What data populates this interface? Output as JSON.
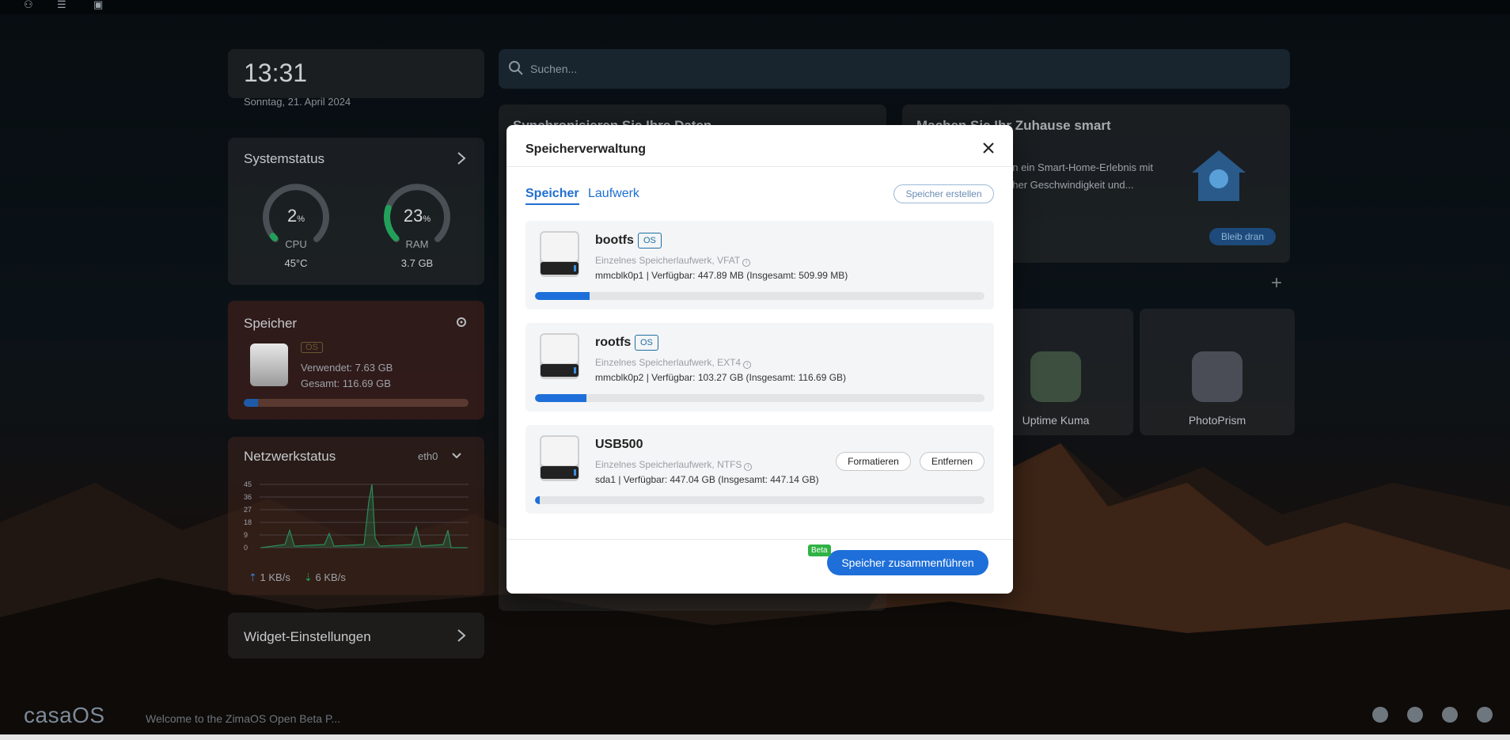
{
  "clock": {
    "time": "13:31",
    "date": "Sonntag, 21. April 2024"
  },
  "system": {
    "title": "Systemstatus",
    "cpu": {
      "value": "2",
      "unit": "%",
      "label": "CPU",
      "sub": "45°C",
      "percent": 2
    },
    "ram": {
      "value": "23",
      "unit": "%",
      "label": "RAM",
      "sub": "3.7 GB",
      "percent": 23
    }
  },
  "storage_widget": {
    "title": "Speicher",
    "badge": "OS",
    "used": "Verwendet: 7.63 GB",
    "total": "Gesamt: 116.69 GB",
    "usage_fraction": 0.065
  },
  "network": {
    "title": "Netzwerkstatus",
    "interface": "eth0",
    "y_ticks": [
      "45",
      "36",
      "27",
      "18",
      "9",
      "0"
    ],
    "up": "1 KB/s",
    "down": "6 KB/s"
  },
  "widget_settings": {
    "title": "Widget-Einstellungen"
  },
  "search": {
    "placeholder": "Suchen..."
  },
  "background_cards": {
    "sync_title": "Synchronisieren Sie Ihre Daten",
    "smart_title": "Machen Sie Ihr Zuhause smart",
    "smart_text_1": "en ein Smart-Home-Erlebnis mit",
    "smart_text_2": "oher Geschwindigkeit und...",
    "smart_button": "Bleib dran"
  },
  "apps": [
    {
      "label": "Uptime Kuma"
    },
    {
      "label": "PhotoPrism"
    }
  ],
  "bottom": {
    "logo": "casaOS",
    "welcome": "Welcome to the ZimaOS Open Beta P..."
  },
  "modal": {
    "title": "Speicherverwaltung",
    "tabs": [
      "Speicher",
      "Laufwerk"
    ],
    "create_button": "Speicher erstellen",
    "storages": [
      {
        "name": "bootfs",
        "badge": "OS",
        "type": "Einzelnes Speicherlaufwerk, VFAT",
        "detail": "mmcblk0p1 | Verfügbar: 447.89 MB (Insgesamt: 509.99 MB)",
        "usage_fraction": 0.122
      },
      {
        "name": "rootfs",
        "badge": "OS",
        "type": "Einzelnes Speicherlaufwerk, EXT4",
        "detail": "mmcblk0p2 | Verfügbar: 103.27 GB (Insgesamt: 116.69 GB)",
        "usage_fraction": 0.115
      },
      {
        "name": "USB500",
        "badge": "",
        "type": "Einzelnes Speicherlaufwerk, NTFS",
        "detail": "sda1 | Verfügbar: 447.04 GB (Insgesamt: 447.14 GB)",
        "usage_fraction": 0.01,
        "actions": [
          "Formatieren",
          "Entfernen"
        ]
      }
    ],
    "beta_badge": "Beta",
    "merge_button": "Speicher zusammenführen"
  }
}
